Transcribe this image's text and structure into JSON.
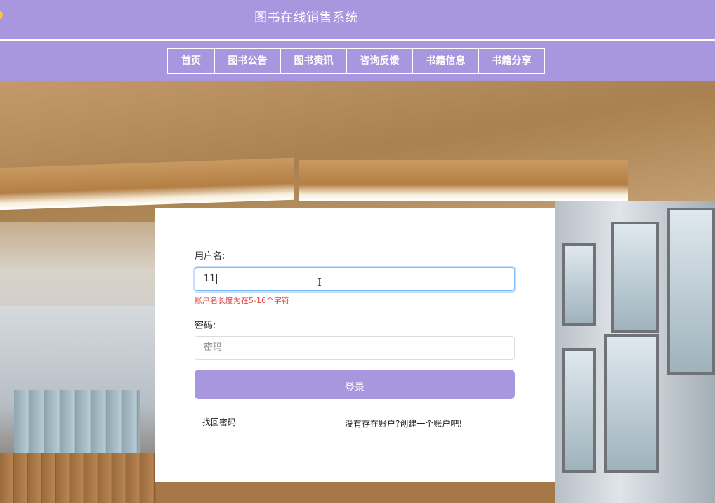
{
  "header": {
    "site_title": "图书在线销售系统"
  },
  "nav": {
    "items": [
      {
        "label": "首页",
        "w": 66
      },
      {
        "label": "图书公告",
        "w": 93
      },
      {
        "label": "图书资讯",
        "w": 93
      },
      {
        "label": "咨询反馈",
        "w": 93
      },
      {
        "label": "书籍信息",
        "w": 93
      },
      {
        "label": "书籍分享",
        "w": 93
      }
    ]
  },
  "login": {
    "username_label": "用户名:",
    "username_value": "11",
    "username_error": "账户名长度为在5-16个字符",
    "password_label": "密码:",
    "password_placeholder": "密码",
    "submit_label": "登录",
    "forgot_link": "找回密码",
    "register_link": "没有存在账户?创建一个账户吧!"
  },
  "colors": {
    "accent": "#a897df",
    "error": "#e0443e",
    "focus": "#80bdff"
  }
}
